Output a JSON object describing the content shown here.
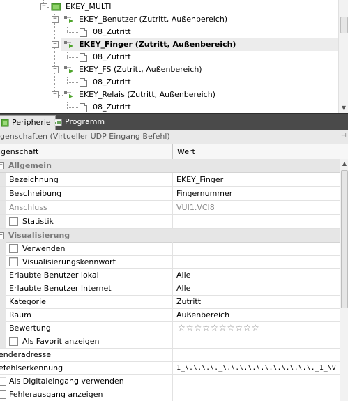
{
  "tree": {
    "root": {
      "label": "EKEY_MULTI"
    },
    "nodes": [
      {
        "label": "EKEY_Benutzer (Zutritt, Außenbereich)",
        "child": "08_Zutritt",
        "selected": false
      },
      {
        "label": "EKEY_Finger (Zutritt, Außenbereich)",
        "child": "08_Zutritt",
        "selected": true
      },
      {
        "label": "EKEY_FS (Zutritt, Außenbereich)",
        "child": "08_Zutritt",
        "selected": false
      },
      {
        "label": "EKEY_Relais (Zutritt, Außenbereich)",
        "child": "08_Zutritt",
        "selected": false
      }
    ]
  },
  "tabs": [
    {
      "label": "Peripherie",
      "icon": "peripherie-icon",
      "active": true
    },
    {
      "label": "Programm",
      "icon": "programm-icon",
      "active": false
    }
  ],
  "properties": {
    "title": "igenschaften (Virtueller UDP Eingang Befehl)",
    "col_name": "igenschaft",
    "col_value": "Wert"
  },
  "grid": {
    "cat_allgemein": "Allgemein",
    "bezeichnung": {
      "name": "Bezeichnung",
      "value": "EKEY_Finger"
    },
    "beschreibung": {
      "name": "Beschreibung",
      "value": "Fingernummer"
    },
    "anschluss": {
      "name": "Anschluss",
      "value": "VUI1.VCI8"
    },
    "statistik": {
      "name": "Statistik"
    },
    "cat_visualisierung": "Visualisierung",
    "verwenden": {
      "name": "Verwenden"
    },
    "vis_kennwort": {
      "name": "Visualisierungskennwort"
    },
    "benutzer_lokal": {
      "name": "Erlaubte Benutzer lokal",
      "value": "Alle"
    },
    "benutzer_internet": {
      "name": "Erlaubte Benutzer Internet",
      "value": "Alle"
    },
    "kategorie": {
      "name": "Kategorie",
      "value": "Zutritt"
    },
    "raum": {
      "name": "Raum",
      "value": "Außenbereich"
    },
    "bewertung": {
      "name": "Bewertung",
      "value": "☆☆☆☆☆☆☆☆☆☆",
      "stars_filled": 0,
      "stars_total": 10
    },
    "favorit": {
      "name": "Als Favorit anzeigen"
    },
    "senderadresse": {
      "name": "enderadresse"
    },
    "befehlserkennung": {
      "name": "efehlserkennung",
      "value": "1_\\.\\.\\.\\._\\.\\.\\.\\.\\.\\.\\.\\.\\.\\.\\._1_\\v"
    },
    "digitaleingang": {
      "name": "Als Digitaleingang verwenden"
    },
    "fehlerausgang": {
      "name": "Fehlerausgang anzeigen"
    }
  }
}
